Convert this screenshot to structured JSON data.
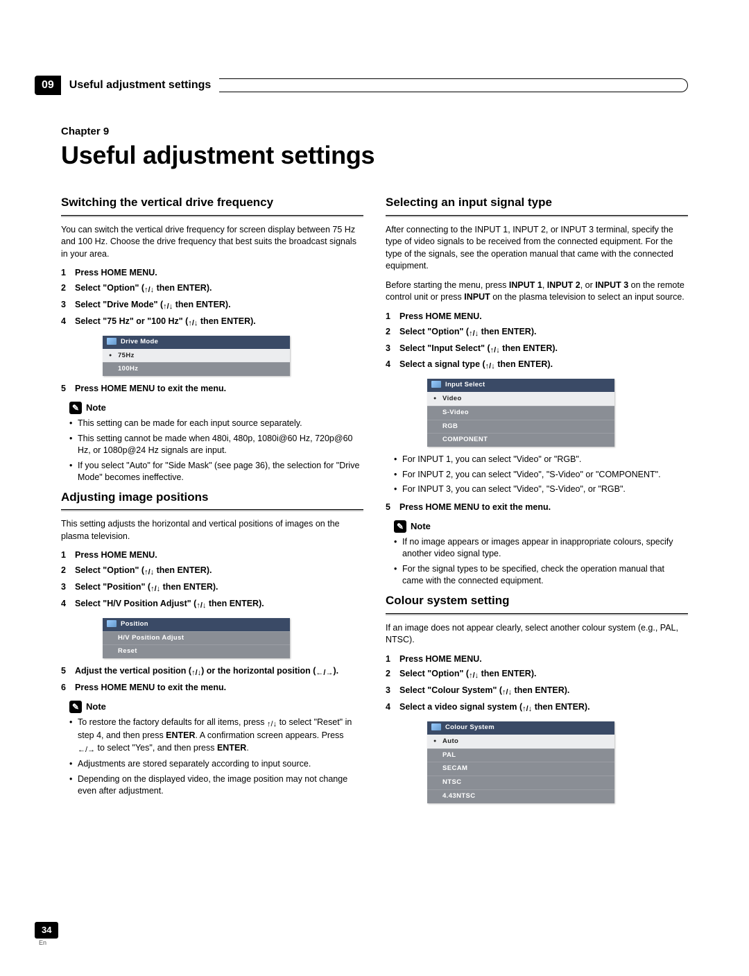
{
  "header": {
    "chapter_num": "09",
    "chapter_label": "Useful adjustment settings",
    "pre": "Chapter 9",
    "title": "Useful adjustment settings"
  },
  "arrows": {
    "ud": "↑/↓",
    "lr": "←/→"
  },
  "left": {
    "sec1": {
      "title": "Switching the vertical drive frequency",
      "intro": "You can switch the vertical drive frequency for screen display between 75 Hz and 100 Hz. Choose the drive frequency that best suits the broadcast signals in your area.",
      "steps": [
        "Press HOME MENU.",
        "Select \"Option\" ({UD} then ENTER).",
        "Select \"Drive Mode\" ({UD} then ENTER).",
        "Select \"75 Hz\" or \"100 Hz\" ({UD} then ENTER).",
        "Press HOME MENU to exit the menu."
      ],
      "menu": {
        "title": "Drive Mode",
        "rows": [
          "75Hz",
          "100Hz"
        ],
        "selected": 0
      },
      "note_label": "Note",
      "notes": [
        "This setting can be made for each input source separately.",
        "This setting cannot be made when 480i, 480p, 1080i@60 Hz, 720p@60 Hz, or 1080p@24 Hz signals are input.",
        "If you select \"Auto\" for \"Side Mask\" (see page 36), the selection for \"Drive Mode\" becomes ineffective."
      ]
    },
    "sec2": {
      "title": "Adjusting image positions",
      "intro": "This setting adjusts the horizontal and vertical positions of images on the plasma television.",
      "steps": [
        "Press HOME MENU.",
        "Select \"Option\" ({UD} then ENTER).",
        "Select \"Position\" ({UD} then ENTER).",
        "Select \"H/V Position Adjust\" ({UD} then ENTER).",
        "Adjust the vertical position ({UD}) or the horizontal position ({LR}).",
        "Press HOME MENU to exit the menu."
      ],
      "menu": {
        "title": "Position",
        "rows": [
          "H/V Position Adjust",
          "Reset"
        ],
        "selected": -1
      },
      "note_label": "Note",
      "notes_html": [
        "To restore the factory defaults for all items, press {UD} to select \"Reset\" in step 4, and then press {B:ENTER}. A confirmation screen appears. Press {LR} to select \"Yes\", and then press {B:ENTER}.",
        "Adjustments are stored separately according to input source.",
        "Depending on the displayed video, the image position may not change even after adjustment."
      ]
    }
  },
  "right": {
    "sec1": {
      "title": "Selecting an input signal type",
      "intro1": "After connecting to the INPUT 1, INPUT 2, or INPUT 3 terminal, specify the type of video signals to be received from the connected equipment. For the type of the signals, see the operation manual that came with the connected equipment.",
      "intro2": "Before starting the menu, press {B:INPUT 1}, {B:INPUT 2}, or {B:INPUT 3} on the remote control unit or press {B:INPUT} on the plasma television to select an input source.",
      "steps": [
        "Press HOME MENU.",
        "Select \"Option\" ({UD} then ENTER).",
        "Select \"Input Select\" ({UD} then ENTER).",
        "Select a signal type ({UD} then ENTER)."
      ],
      "menu": {
        "title": "Input Select",
        "rows": [
          "Video",
          "S-Video",
          "RGB",
          "COMPONENT"
        ],
        "selected": 0
      },
      "bullets": [
        "For INPUT 1, you can select \"Video\" or \"RGB\".",
        "For INPUT 2, you can select \"Video\", \"S-Video\" or \"COMPONENT\".",
        "For INPUT 3, you can select \"Video\", \"S-Video\", or \"RGB\"."
      ],
      "step5": "Press HOME MENU to exit the menu.",
      "note_label": "Note",
      "notes": [
        "If no image appears or images appear in inappropriate colours, specify another video signal type.",
        "For the signal types to be specified, check the operation manual that came with the connected equipment."
      ]
    },
    "sec2": {
      "title": "Colour system setting",
      "intro": "If an image does not appear clearly, select another colour system (e.g., PAL, NTSC).",
      "steps": [
        "Press HOME MENU.",
        "Select \"Option\" ({UD} then ENTER).",
        "Select \"Colour System\" ({UD} then ENTER).",
        "Select a video signal system ({UD} then ENTER)."
      ],
      "menu": {
        "title": "Colour System",
        "rows": [
          "Auto",
          "PAL",
          "SECAM",
          "NTSC",
          "4.43NTSC"
        ],
        "selected": 0
      }
    }
  },
  "footer": {
    "page": "34",
    "lang": "En"
  }
}
